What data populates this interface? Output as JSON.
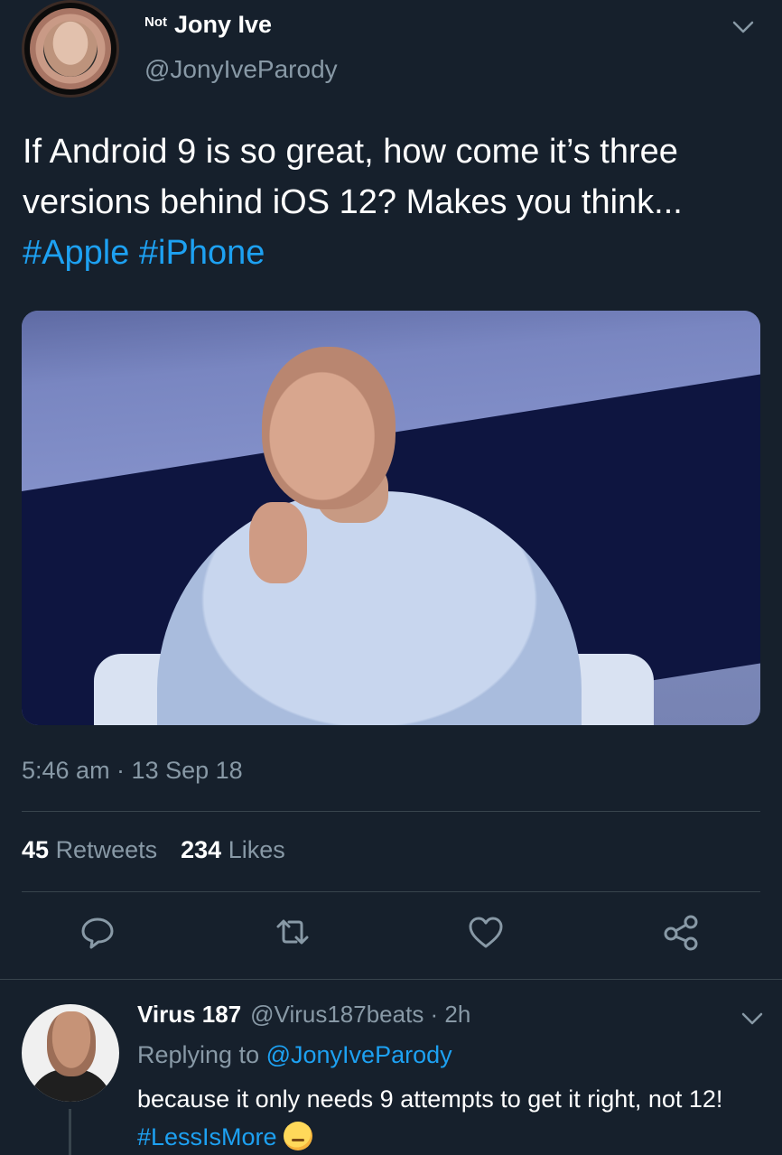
{
  "tweet": {
    "author": {
      "name_prefix": "Not",
      "display_name": "Jony Ive",
      "handle": "@JonyIveParody"
    },
    "text": {
      "body": "If Android 9 is so great, how come it’s three versions behind iOS 12? Makes you think... ",
      "hashtags": [
        "#Apple",
        "#iPhone"
      ]
    },
    "timestamp": "5:46 am · 13 Sep 18",
    "stats": {
      "retweets_count": "45",
      "retweets_label": "Retweets",
      "likes_count": "234",
      "likes_label": "Likes"
    },
    "actions": [
      "reply-icon",
      "retweet-icon",
      "like-icon",
      "share-icon"
    ]
  },
  "reply": {
    "display_name": "Virus 187",
    "handle_time": "@Virus187beats · 2h",
    "replying_to_label": "Replying to",
    "replying_to_mention": "@JonyIveParody",
    "text_body": "because it only needs 9 attempts to get it right, not 12! ",
    "hashtag": "#LessIsMore",
    "emoji": "smirking-face-icon"
  },
  "colors": {
    "background": "#16202c",
    "accent": "#1da1f2",
    "secondary_text": "#8899a6",
    "divider": "#38444d"
  }
}
